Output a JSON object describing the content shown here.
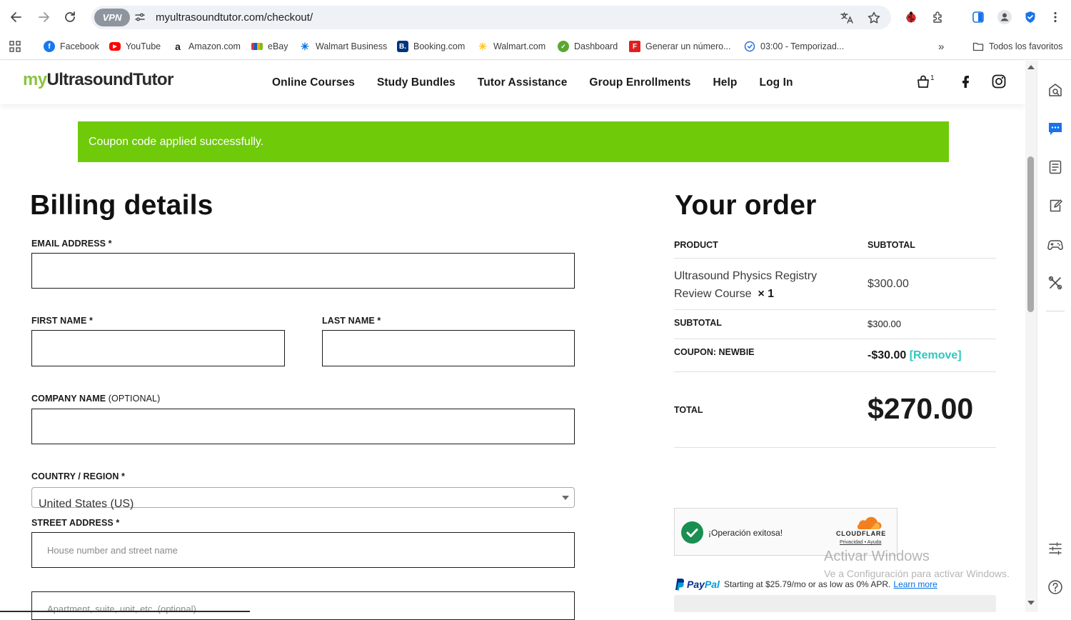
{
  "browser": {
    "vpn_label": "VPN",
    "url": "myultrasoundtutor.com/checkout/",
    "bookmarks": [
      {
        "label": "Facebook",
        "icon": "facebook-icon",
        "color": "#1877f2"
      },
      {
        "label": "YouTube",
        "icon": "youtube-icon",
        "color": "#ff0000"
      },
      {
        "label": "Amazon.com",
        "icon": "amazon-icon",
        "color": "#222222"
      },
      {
        "label": "eBay",
        "icon": "ebay-icon",
        "color": "#e53238"
      },
      {
        "label": "Walmart Business",
        "icon": "walmart-icon",
        "color": "#0071dc"
      },
      {
        "label": "Booking.com",
        "icon": "booking-icon",
        "color": "#003580"
      },
      {
        "label": "Walmart.com",
        "icon": "walmart-spark-icon",
        "color": "#ffc220"
      },
      {
        "label": "Dashboard",
        "icon": "dashboard-icon",
        "color": "#5aa832"
      },
      {
        "label": "Generar un número...",
        "icon": "generator-icon",
        "color": "#e02020"
      },
      {
        "label": "03:00 - Temporizad...",
        "icon": "timer-icon",
        "color": "#2d6cdf"
      }
    ],
    "more_label": "»",
    "all_bookmarks": "Todos los favoritos"
  },
  "site": {
    "logo_my": "my",
    "logo_rest": "UltrasoundTutor",
    "nav": [
      "Online Courses",
      "Study Bundles",
      "Tutor Assistance",
      "Group Enrollments",
      "Help",
      "Log In"
    ],
    "cart_count": "1",
    "accent": "#8ac43f"
  },
  "notice": {
    "text": "Coupon code applied successfully.",
    "color": "#6fca09"
  },
  "billing": {
    "title": "Billing details",
    "email_label": "EMAIL ADDRESS",
    "first_label": "FIRST NAME",
    "last_label": "LAST NAME",
    "company_label": "COMPANY NAME",
    "company_optional": "(OPTIONAL)",
    "country_label": "COUNTRY / REGION",
    "country_value": "United States (US)",
    "street_label": "STREET ADDRESS",
    "street_placeholder": "House number and street name",
    "apt_placeholder": "Apartment, suite, unit, etc. (optional)",
    "required_mark": "*"
  },
  "order": {
    "title": "Your order",
    "col_product": "PRODUCT",
    "col_subtotal": "SUBTOTAL",
    "product_name": "Ultrasound Physics Registry Review Course",
    "product_qty": "× 1",
    "product_price": "$300.00",
    "subtotal_label": "SUBTOTAL",
    "subtotal_value": "$300.00",
    "coupon_label": "COUPON: NEWBIE",
    "coupon_value": "-$30.00",
    "remove_label": "[Remove]",
    "total_label": "TOTAL",
    "total_value": "$270.00"
  },
  "turnstile": {
    "status": "¡Operación exitosa!",
    "brand": "CLOUDFLARE",
    "privacy": "Privacidad",
    "help": "Ayuda",
    "separator": "•"
  },
  "watermark": {
    "line1": "Activar Windows",
    "line2": "Ve a Configuración para activar Windows."
  },
  "paypal": {
    "logo_pay": "Pay",
    "logo_pal": "Pal",
    "text": "Starting at $25.79/mo or as low as 0% APR.",
    "link": "Learn more"
  }
}
